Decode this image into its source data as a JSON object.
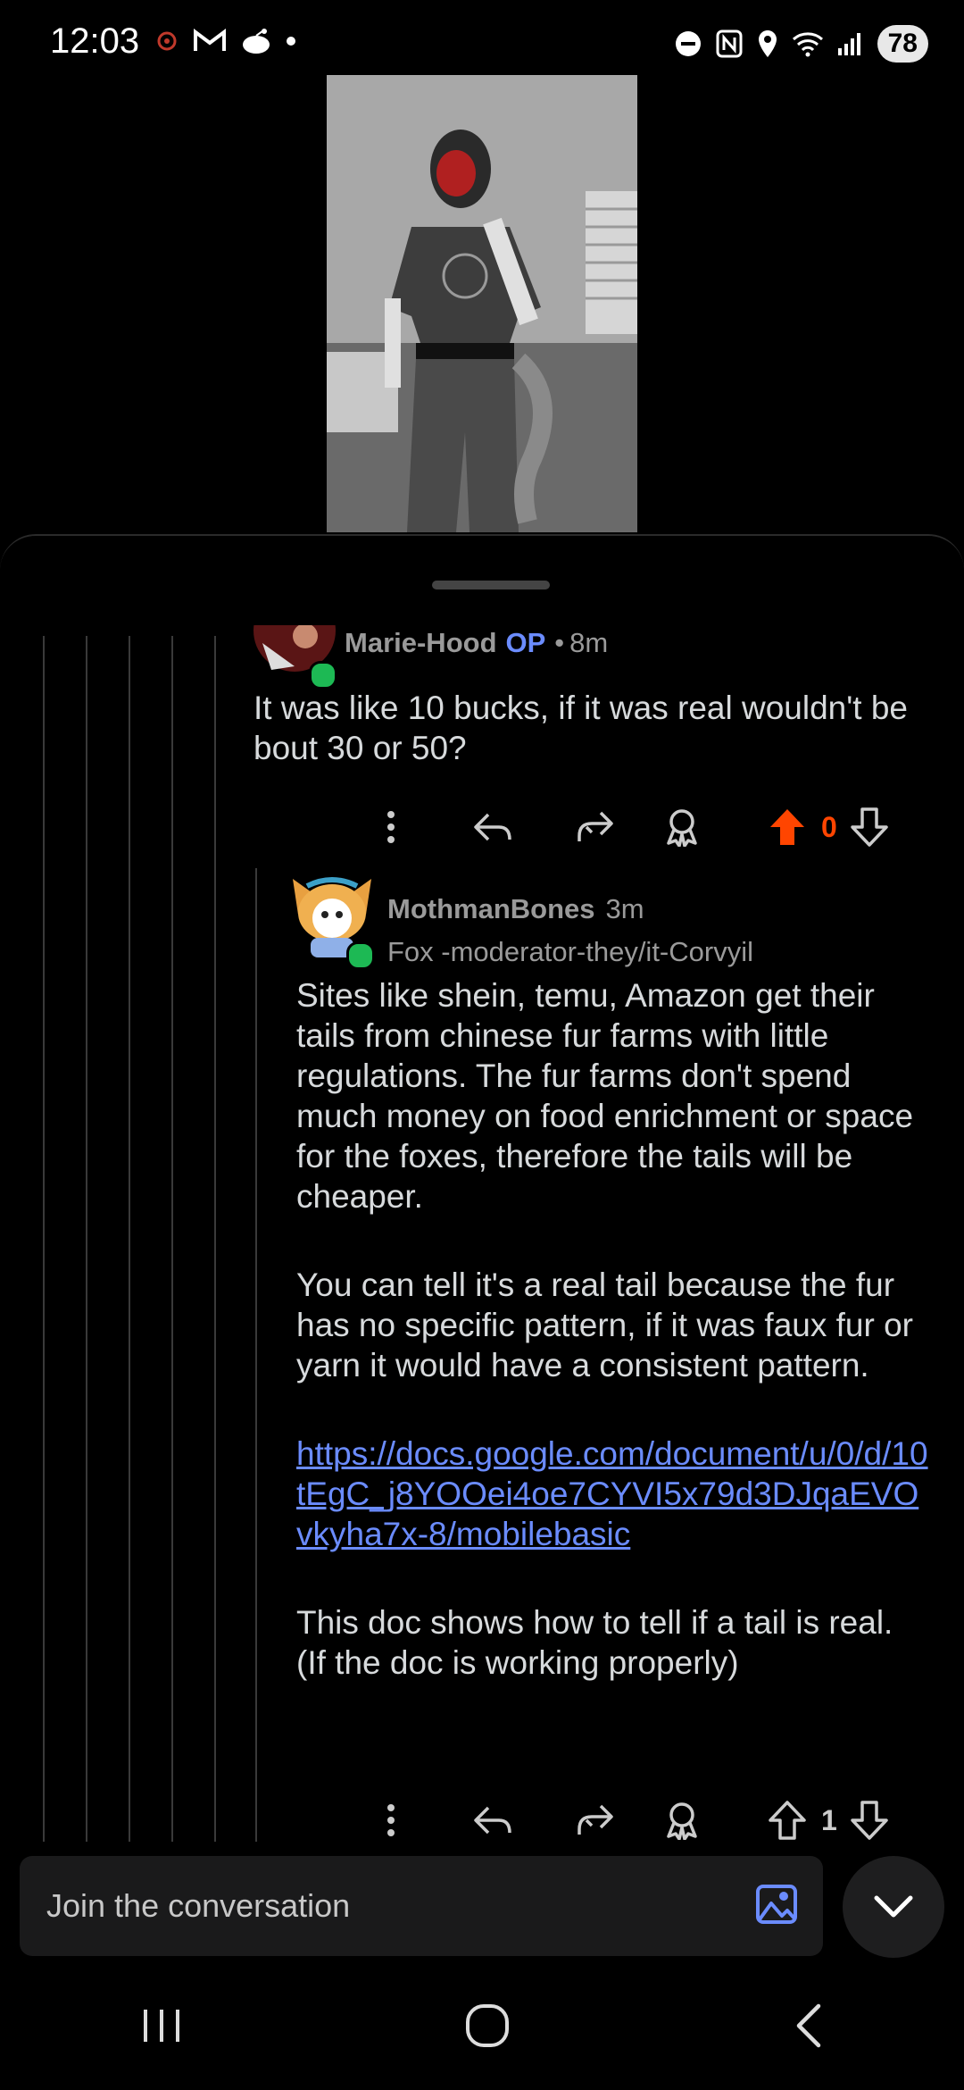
{
  "status_bar": {
    "time": "12:03",
    "battery": "78"
  },
  "parent_comment": {
    "username": "Marie-Hood",
    "op_tag": "OP",
    "separator": "•",
    "age": "8m",
    "text": "It was like 10 bucks, if it was real wouldn't be bout 30 or 50?",
    "vote_count": "0"
  },
  "reply_comment": {
    "username": "MothmanBones",
    "age": "3m",
    "flair": "Fox -moderator-they/it-Corvyil",
    "paragraph1": "Sites like shein, temu, Amazon get their tails from chinese fur farms with little regulations. The fur farms don't spend much money on food enrichment or space for the foxes, therefore the tails will be cheaper.",
    "paragraph2": "You can tell it's a real tail because the fur has no specific pattern, if it was faux fur or yarn it would have a consistent pattern.",
    "link": "https://docs.google.com/document/u/0/d/10tEgC_j8YOOei4oe7CYVI5x79d3DJqaEVOvkyha7x-8/mobilebasic",
    "paragraph3": "This doc shows how to tell if a tail is real. (If the doc is working properly)",
    "vote_count": "1"
  },
  "composer": {
    "placeholder": "Join the conversation"
  },
  "colors": {
    "upvote_active": "#ff4500",
    "link": "#6b8cff",
    "background": "#000000"
  }
}
